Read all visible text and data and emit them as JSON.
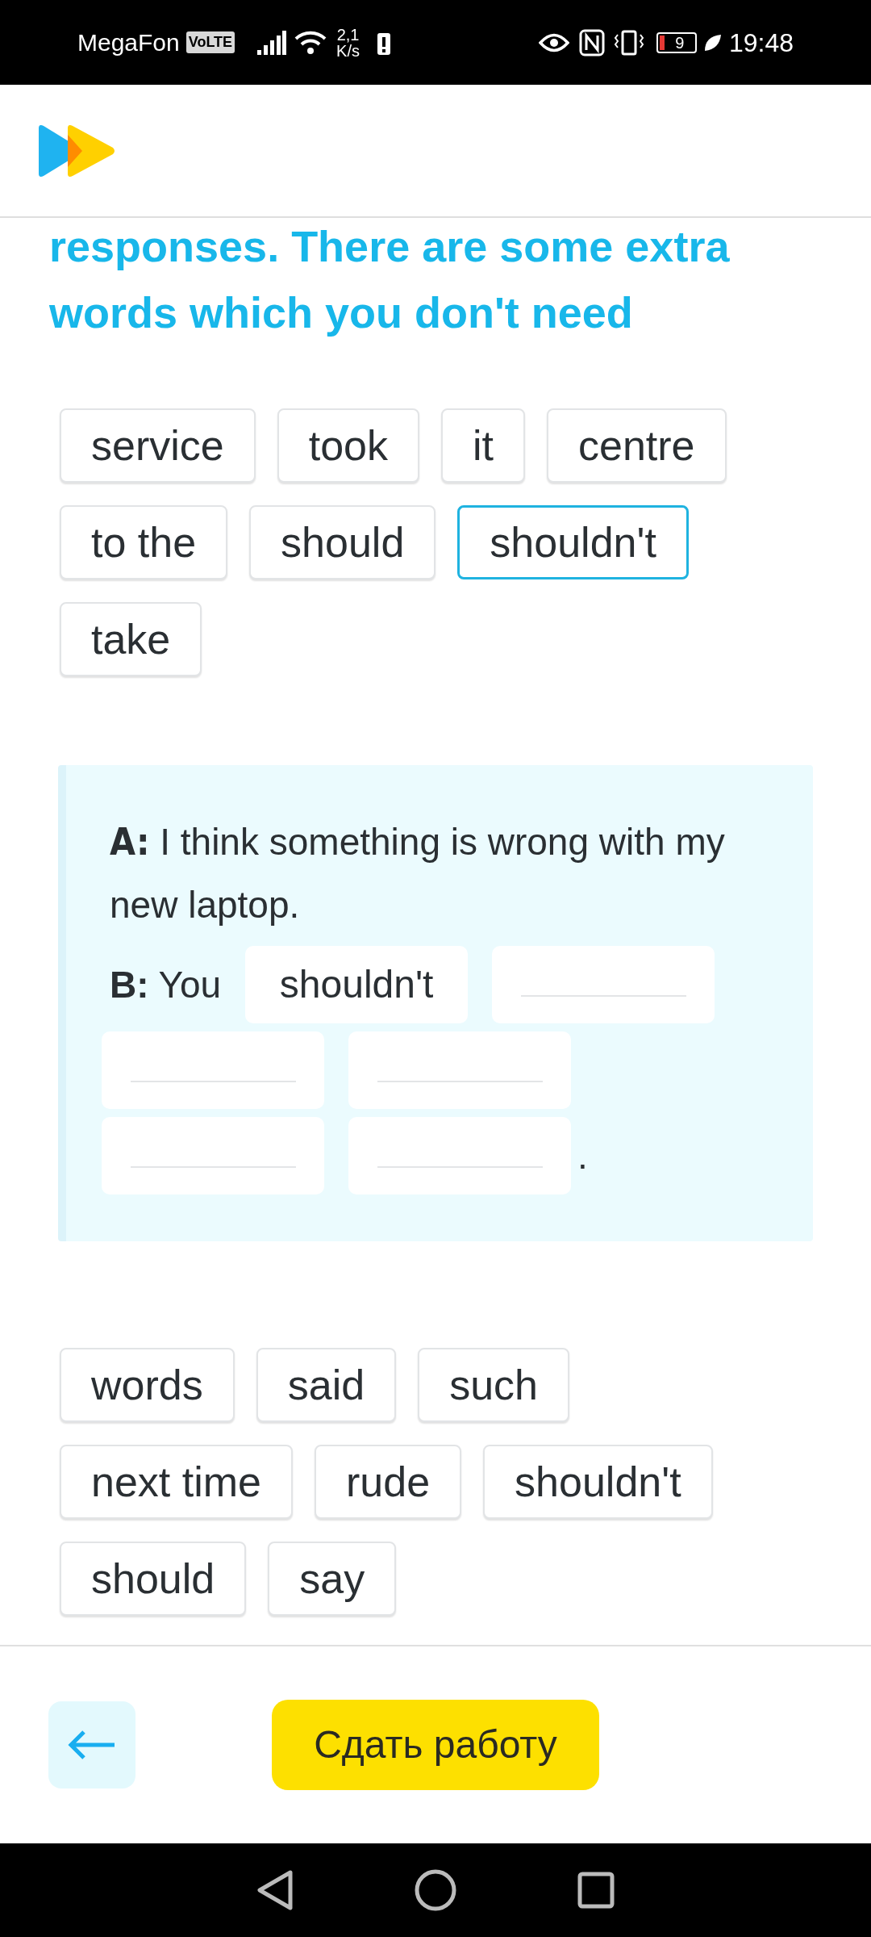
{
  "status_bar": {
    "carrier": "MegaFon",
    "volte": "VoLTE",
    "speed_value": "2,1",
    "speed_unit": "K/s",
    "battery": "9",
    "time": "19:48"
  },
  "instruction": {
    "lines": [
      "responses. There are some extra",
      "words which you don't need"
    ]
  },
  "word_bank_top": [
    {
      "text": "service",
      "selected": false
    },
    {
      "text": "took",
      "selected": false
    },
    {
      "text": "it",
      "selected": false
    },
    {
      "text": "centre",
      "selected": false
    },
    {
      "text": "to the",
      "selected": false
    },
    {
      "text": "should",
      "selected": false
    },
    {
      "text": "shouldn't",
      "selected": true
    },
    {
      "text": "take",
      "selected": false
    }
  ],
  "dialogue": {
    "a_label": "A:",
    "a_text": "I think something is wrong with my new laptop.",
    "b_label": "B:",
    "b_text": "You",
    "slots": [
      {
        "filled": true,
        "word": "shouldn't"
      },
      {
        "filled": false
      },
      {
        "filled": false
      },
      {
        "filled": false
      },
      {
        "filled": false
      },
      {
        "filled": false
      }
    ],
    "end": "."
  },
  "word_bank_bottom": [
    {
      "text": "words",
      "selected": false
    },
    {
      "text": "said",
      "selected": false
    },
    {
      "text": "such",
      "selected": false
    },
    {
      "text": "next time",
      "selected": false
    },
    {
      "text": "rude",
      "selected": false
    },
    {
      "text": "shouldn't",
      "selected": false
    },
    {
      "text": "should",
      "selected": false
    },
    {
      "text": "say",
      "selected": false
    }
  ],
  "footer": {
    "submit": "Сдать работу"
  }
}
